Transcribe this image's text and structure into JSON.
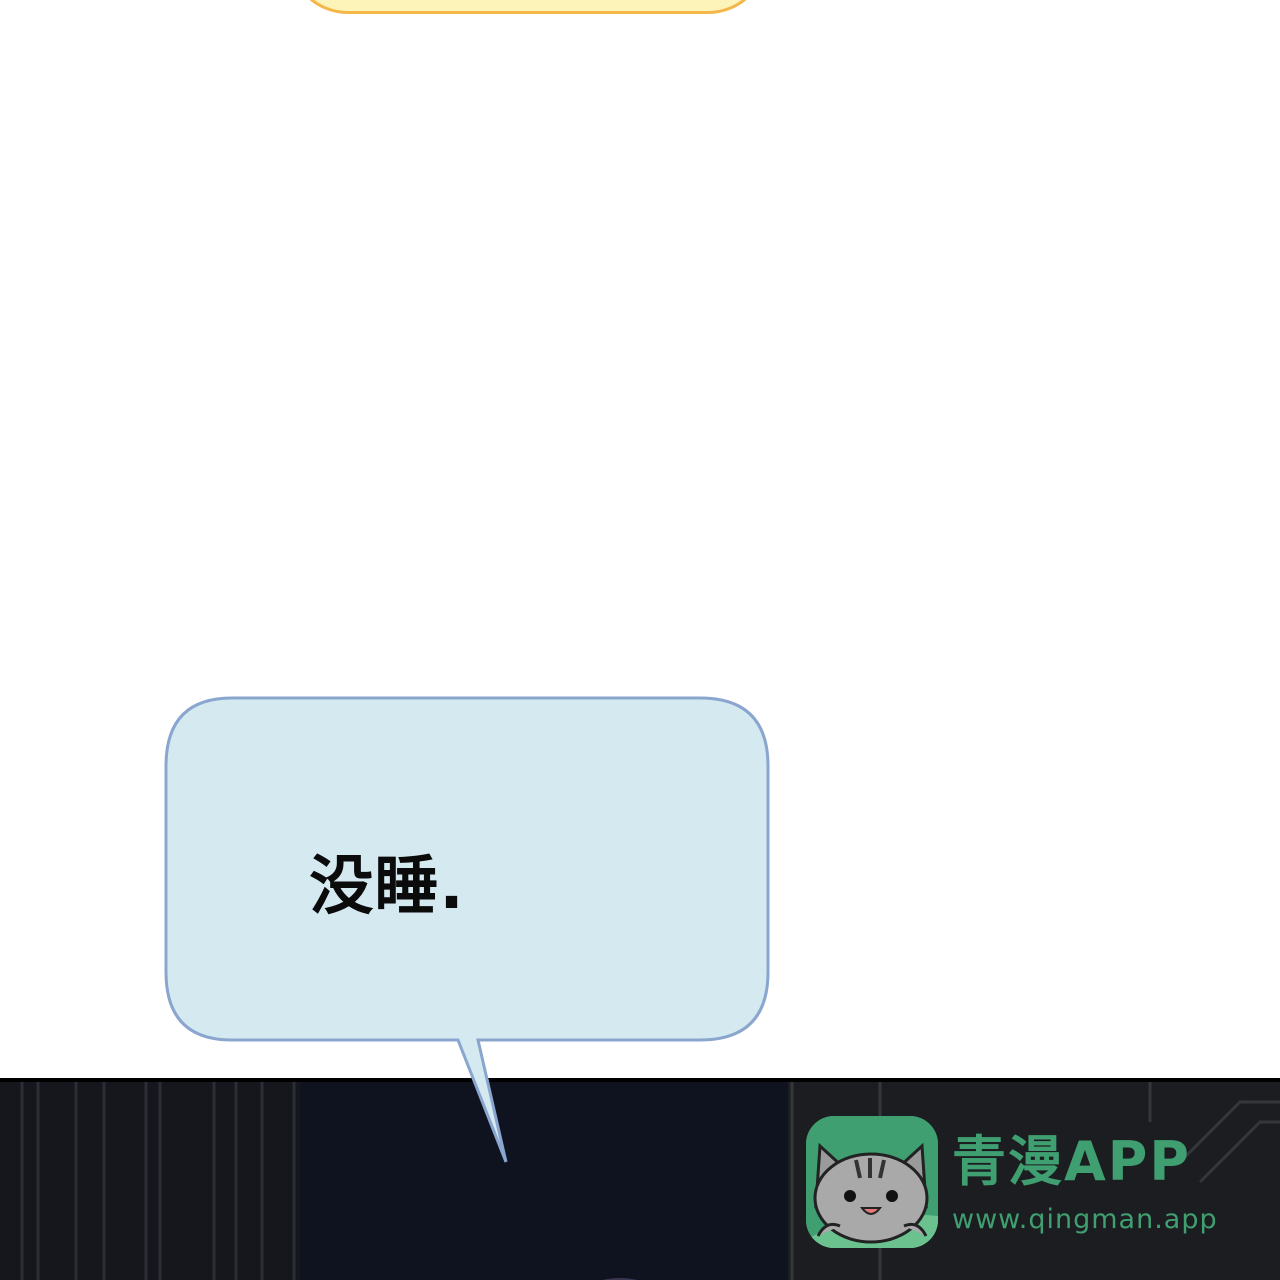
{
  "speech_bubble": {
    "text": "没睡.",
    "fill": "#d5eaf0",
    "stroke": "#8aa6cf"
  },
  "top_bubble": {
    "fill": "#fdf4b9",
    "stroke": "#f5b64a"
  },
  "watermark": {
    "title": "青漫APP",
    "url": "www.qingman.app",
    "icon": "cat-mascot-icon",
    "color": "#3f9f71"
  }
}
